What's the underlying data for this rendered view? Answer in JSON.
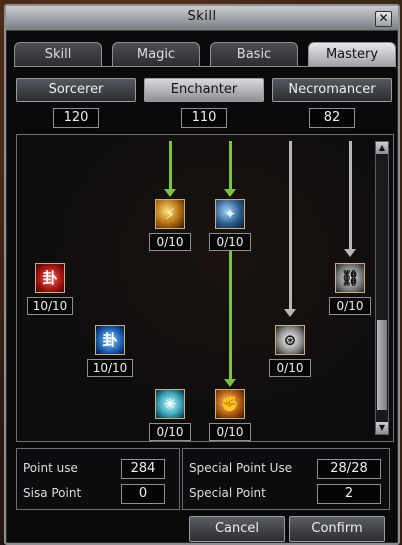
{
  "window": {
    "title": "Skill",
    "close_glyph": "✕"
  },
  "tabs": [
    {
      "label": "Skill"
    },
    {
      "label": "Magic"
    },
    {
      "label": "Basic"
    },
    {
      "label": "Mastery"
    }
  ],
  "active_tab": "Mastery",
  "classes": [
    {
      "label": "Sorcerer",
      "points": "120"
    },
    {
      "label": "Enchanter",
      "points": "110"
    },
    {
      "label": "Necromancer",
      "points": "82"
    }
  ],
  "active_class": "Enchanter",
  "skills": [
    {
      "name": "lightning-skill",
      "level": "0/10"
    },
    {
      "name": "blade-strike-skill",
      "level": "0/10"
    },
    {
      "name": "seal-fire-skill",
      "level": "10/10"
    },
    {
      "name": "chain-skill",
      "level": "0/10"
    },
    {
      "name": "seal-ice-skill",
      "level": "10/10"
    },
    {
      "name": "curse-skill",
      "level": "0/10"
    },
    {
      "name": "frost-star-skill",
      "level": "0/10"
    },
    {
      "name": "power-fist-skill",
      "level": "0/10"
    }
  ],
  "stats": {
    "point_use_label": "Point use",
    "point_use_value": "284",
    "sisa_point_label": "Sisa Point",
    "sisa_point_value": "0",
    "special_point_use_label": "Special Point Use",
    "special_point_use_value": "28/28",
    "special_point_label": "Special Point",
    "special_point_value": "2"
  },
  "buttons": {
    "cancel": "Cancel",
    "confirm": "Confirm"
  },
  "colors": {
    "prereq_met": "#7cc23f",
    "prereq_unmet": "#b8b8b8"
  }
}
